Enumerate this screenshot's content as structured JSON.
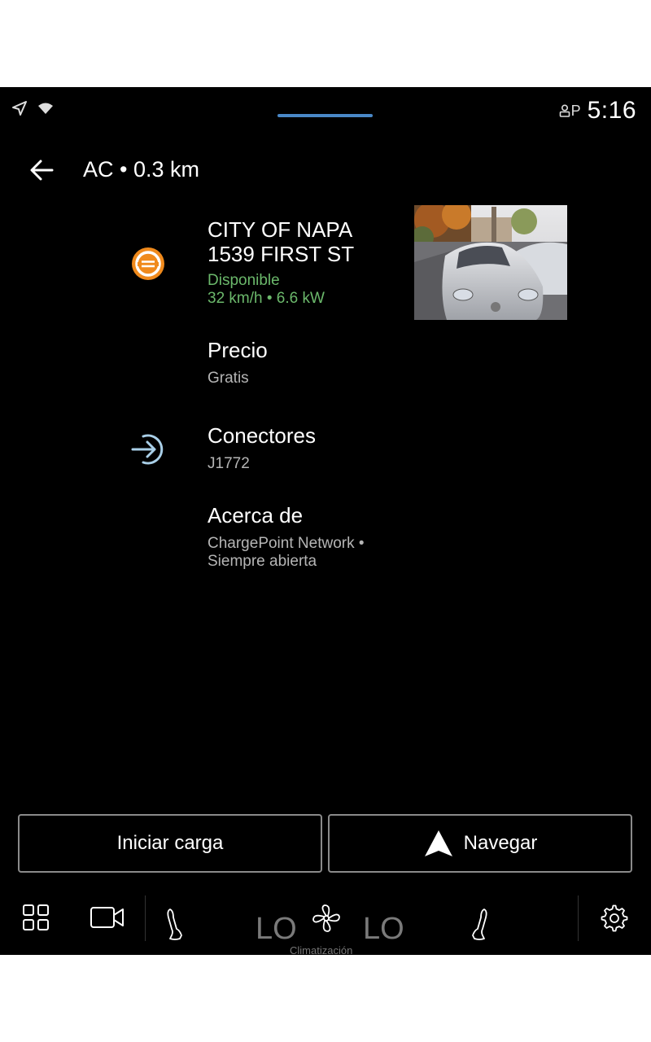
{
  "status_bar": {
    "time": "5:16",
    "icons": [
      "navigation-arrow-icon",
      "wifi-icon",
      "user-profile-icon",
      "parking-icon"
    ],
    "profile_letter": "P"
  },
  "header": {
    "title": "AC • 0.3 km"
  },
  "station": {
    "name_line1": "CITY OF NAPA",
    "name_line2": "1539 FIRST ST",
    "status": "Disponible",
    "speed": "32 km/h • 6.6 kW"
  },
  "price": {
    "label": "Precio",
    "value": "Gratis"
  },
  "connectors": {
    "label": "Conectores",
    "value": "J1772"
  },
  "about": {
    "label": "Acerca de",
    "line1": "ChargePoint Network •",
    "line2": "Siempre abierta"
  },
  "actions": {
    "start_charge": "Iniciar carga",
    "navigate": "Navegar"
  },
  "climate": {
    "left_temp": "LO",
    "right_temp": "LO",
    "label": "Climatización"
  },
  "colors": {
    "accent_blue": "#4a88c7",
    "charger_orange": "#f08a1c",
    "available_green": "#6bb86b",
    "connector_blue": "#a9cfe8"
  }
}
